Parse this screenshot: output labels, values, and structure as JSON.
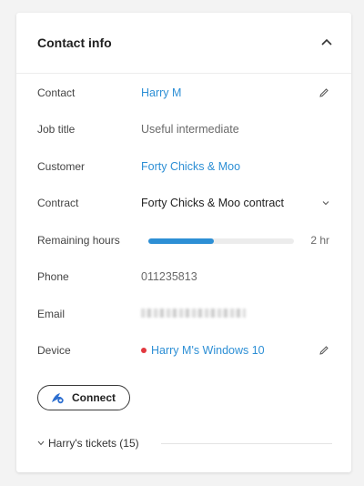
{
  "card": {
    "title": "Contact info",
    "collapse_icon": "chevron-up-icon"
  },
  "fields": {
    "contact": {
      "label": "Contact",
      "value": "Harry M",
      "icon": "pencil-icon"
    },
    "job_title": {
      "label": "Job title",
      "value": "Useful intermediate"
    },
    "customer": {
      "label": "Customer",
      "value": "Forty Chicks & Moo"
    },
    "contract": {
      "label": "Contract",
      "value": "Forty Chicks & Moo contract",
      "icon": "chevron-down-icon"
    },
    "remaining_hours": {
      "label": "Remaining hours",
      "value": "2 hr",
      "progress_fraction": 0.45
    },
    "phone": {
      "label": "Phone",
      "value": "011235813"
    },
    "email": {
      "label": "Email"
    },
    "device": {
      "label": "Device",
      "value": "Harry M's Windows 10",
      "status_color": "#e2383f",
      "icon": "pencil-icon"
    }
  },
  "connect": {
    "label": "Connect",
    "icon": "remote-connect-icon"
  },
  "tickets": {
    "label": "Harry's tickets (15)",
    "icon": "chevron-down-icon"
  },
  "colors": {
    "accent": "#2d8fd5",
    "status_offline": "#e2383f"
  }
}
